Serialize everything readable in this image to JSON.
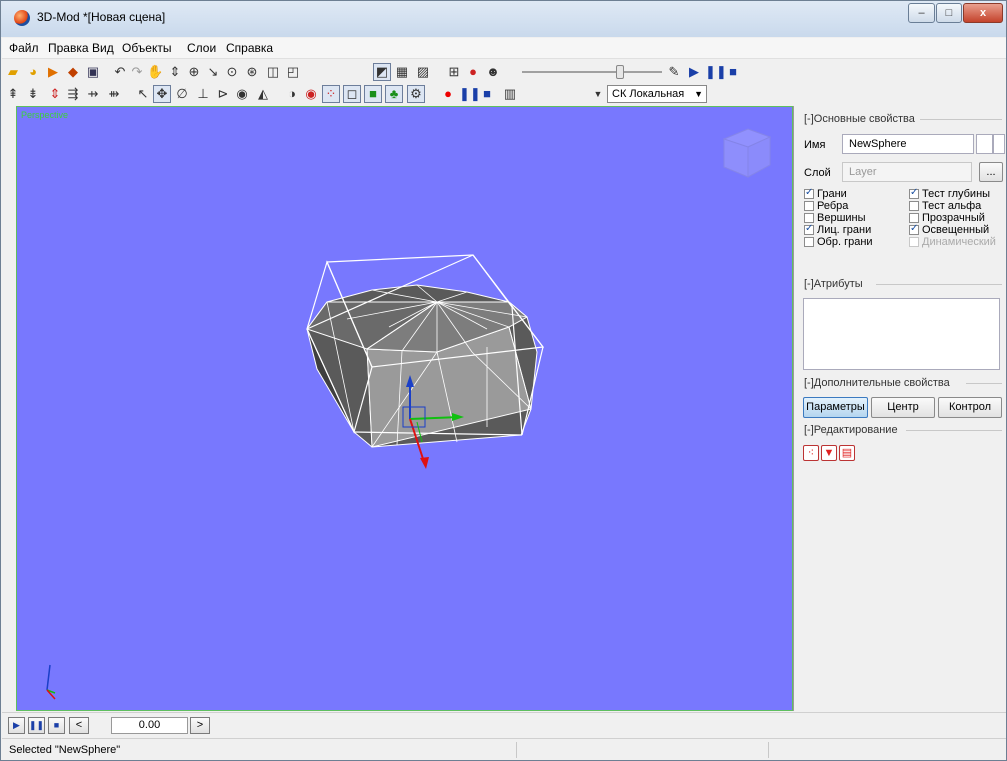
{
  "window": {
    "title": "3D-Mod *[Новая сцена]",
    "minimize": "–",
    "maximize": "□",
    "close": "x"
  },
  "menu": [
    "Файл",
    "Правка",
    "Вид",
    "Объекты",
    "Слои",
    "Справка"
  ],
  "toolbar1": {
    "icons": [
      "open-folder-icon",
      "open-recent-icon",
      "import-icon",
      "export-icon",
      "save-icon",
      "undo-icon",
      "redo-icon",
      "pan-hand-icon",
      "rotate-icon",
      "orbit-icon",
      "fly-icon",
      "zoom-icon",
      "zoom-extents-icon",
      "box-view-icon",
      "perspective-icon",
      "wireframe-icon",
      "grid-icon",
      "texture-icon",
      "layout-icon",
      "camera-icon",
      "skull-icon"
    ],
    "slider_level": 0.7,
    "play_icons": [
      "measure-icon",
      "play-icon",
      "pause-icon",
      "stop-icon"
    ]
  },
  "toolbar2": {
    "icons": [
      "tool-1-icon",
      "tool-2-icon",
      "tool-3-icon",
      "tool-4-icon",
      "tool-5-icon",
      "tool-6-icon",
      "select-arrow-icon",
      "move-icon",
      "lasso-icon",
      "align-icon",
      "transform-icon",
      "eye-icon",
      "scale-icon",
      "visibility-icon",
      "eye-red-icon",
      "vertices-icon",
      "faces-icon",
      "solid-icon",
      "tree-icon",
      "settings-icon",
      "record-icon",
      "pause-icon",
      "stop-icon",
      "render-icon",
      "dropdown-arrow-icon"
    ],
    "coord_system": "СК Локальная"
  },
  "viewport": {
    "label": "Perspective",
    "background": "#7878fe"
  },
  "properties": {
    "section_basic": "[-]Основные свойства",
    "name_label": "Имя",
    "name_value": "NewSphere",
    "layer_label": "Слой",
    "layer_value": "Layer",
    "browse_button": "...",
    "checkboxes_left": [
      {
        "label": "Грани",
        "checked": true
      },
      {
        "label": "Ребра",
        "checked": false
      },
      {
        "label": "Вершины",
        "checked": false
      },
      {
        "label": "Лиц. грани",
        "checked": true
      },
      {
        "label": "Обр. грани",
        "checked": false
      }
    ],
    "checkboxes_right": [
      {
        "label": "Тест глубины",
        "checked": true
      },
      {
        "label": "Тест альфа",
        "checked": false
      },
      {
        "label": "Прозрачный",
        "checked": false
      },
      {
        "label": "Освещенный",
        "checked": true
      },
      {
        "label": "Динамический",
        "checked": false,
        "disabled": true
      }
    ],
    "section_attributes": "[-]Атрибуты",
    "section_extra": "[-]Дополнительные свойства",
    "tab_params": "Параметры",
    "tab_center": "Центр",
    "tab_control": "Контрол",
    "section_edit": "[-]Редактирование"
  },
  "animation": {
    "time": "0.00",
    "prev": "<",
    "next": ">"
  },
  "status": {
    "text": "Selected \"NewSphere\""
  }
}
